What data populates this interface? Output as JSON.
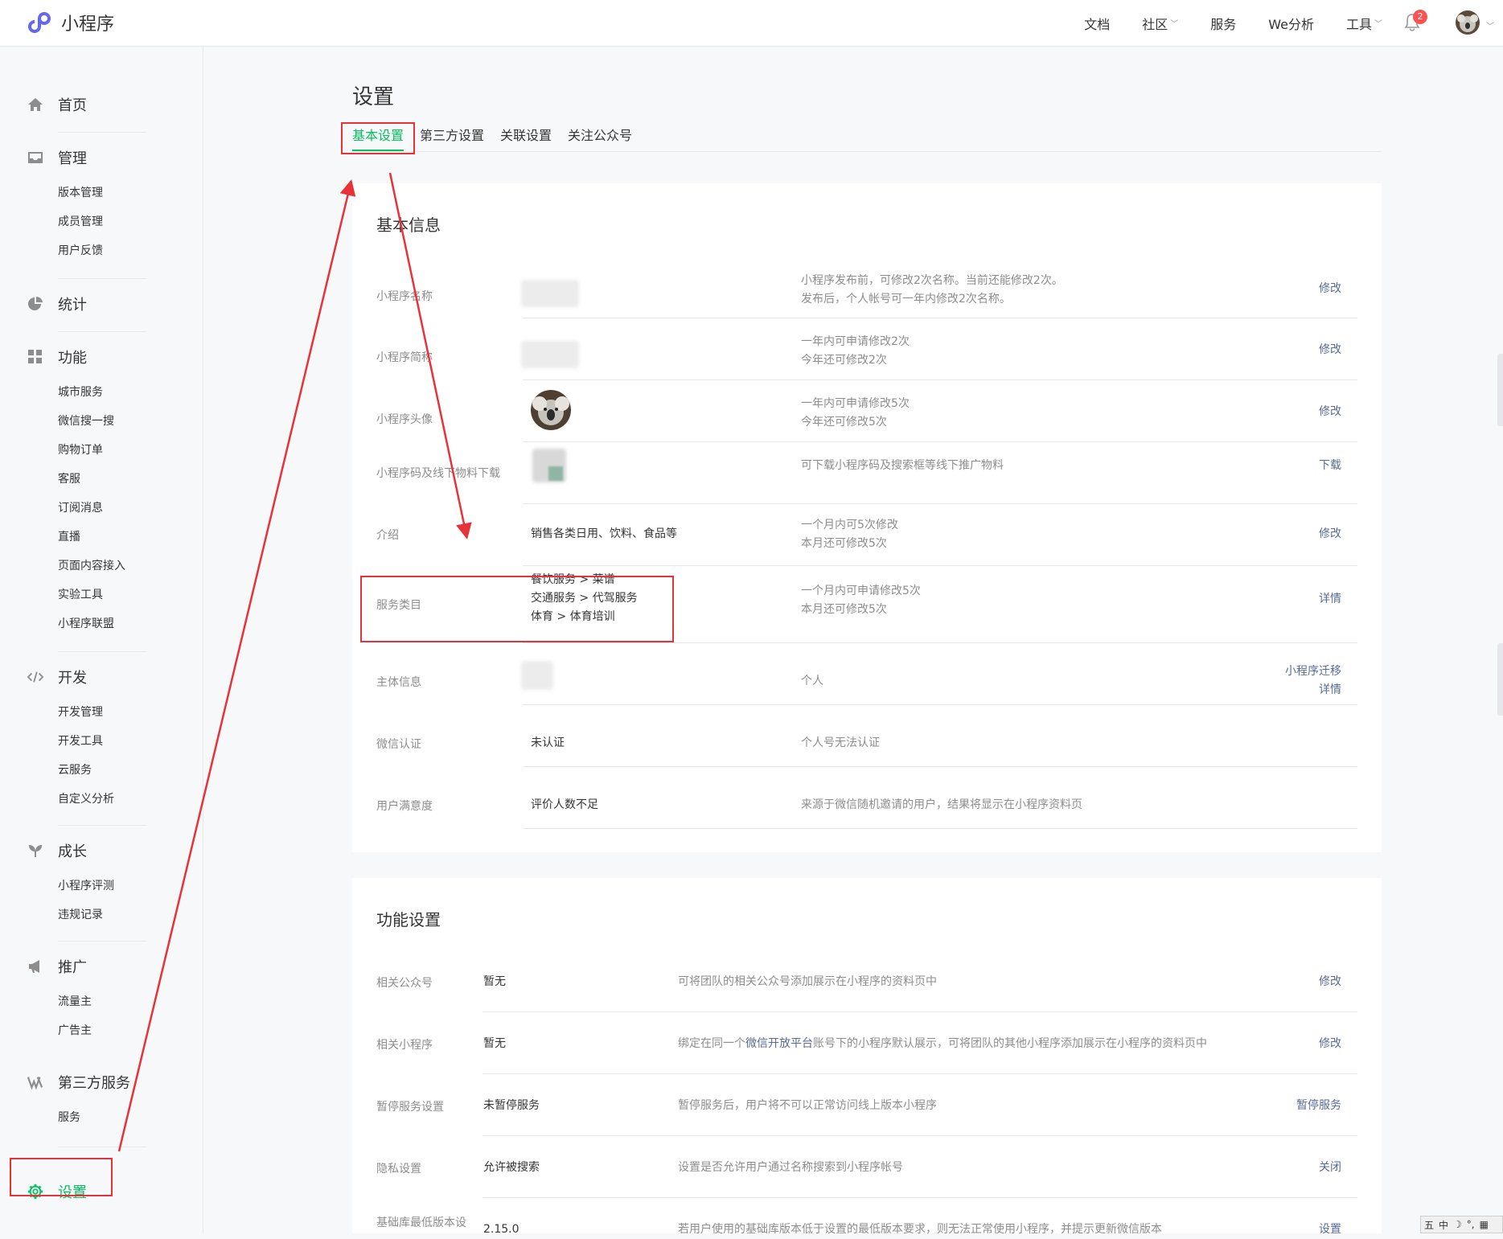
{
  "brand": {
    "name": "小程序"
  },
  "topnav": [
    {
      "label": "文档",
      "caret": false
    },
    {
      "label": "社区",
      "caret": true
    },
    {
      "label": "服务",
      "caret": false
    },
    {
      "label": "We分析",
      "caret": false
    },
    {
      "label": "工具",
      "caret": true
    }
  ],
  "notifications": {
    "count": "2"
  },
  "colors": {
    "accent": "#07c160",
    "link": "#576b95",
    "annotation": "#e8323a",
    "badge": "#fa5151"
  },
  "sidebar": {
    "home": "首页",
    "manage": {
      "title": "管理",
      "items": [
        "版本管理",
        "成员管理",
        "用户反馈"
      ]
    },
    "stats": "统计",
    "features": {
      "title": "功能",
      "items": [
        "城市服务",
        "微信搜一搜",
        "购物订单",
        "客服",
        "订阅消息",
        "直播",
        "页面内容接入",
        "实验工具",
        "小程序联盟"
      ]
    },
    "dev": {
      "title": "开发",
      "items": [
        "开发管理",
        "开发工具",
        "云服务",
        "自定义分析"
      ]
    },
    "growth": {
      "title": "成长",
      "items": [
        "小程序评测",
        "违规记录"
      ]
    },
    "promo": {
      "title": "推广",
      "items": [
        "流量主",
        "广告主"
      ]
    },
    "thirdparty": {
      "title": "第三方服务",
      "items": [
        "服务"
      ]
    },
    "settings": "设置"
  },
  "page": {
    "title": "设置",
    "tabs": [
      "基本设置",
      "第三方设置",
      "关联设置",
      "关注公众号"
    ]
  },
  "basic": {
    "title": "基本信息",
    "rows": [
      {
        "label": "小程序名称",
        "value": "",
        "desc1": "小程序发布前，可修改2次名称。当前还能修改2次。",
        "desc2": "发布后，个人帐号可一年内修改2次名称。",
        "action": "修改"
      },
      {
        "label": "小程序简称",
        "value": "",
        "desc1": "一年内可申请修改2次",
        "desc2": "今年还可修改2次",
        "action": "修改"
      },
      {
        "label": "小程序头像",
        "value": "",
        "desc1": "一年内可申请修改5次",
        "desc2": "今年还可修改5次",
        "action": "修改"
      },
      {
        "label": "小程序码及线下物料下载",
        "value": "",
        "desc1": "可下载小程序码及搜索框等线下推广物料",
        "desc2": "",
        "action": "下载"
      },
      {
        "label": "介绍",
        "value": "销售各类日用、饮料、食品等",
        "desc1": "一个月内可5次修改",
        "desc2": "本月还可修改5次",
        "action": "修改"
      },
      {
        "label": "服务类目",
        "value1": "餐饮服务 > 菜谱",
        "value2": "交通服务 > 代驾服务",
        "value3": "体育 > 体育培训",
        "desc1": "一个月内可申请修改5次",
        "desc2": "本月还可修改5次",
        "action": "详情"
      },
      {
        "label": "主体信息",
        "value": "",
        "desc1": "个人",
        "desc2": "",
        "action": "小程序迁移",
        "action2": "详情"
      },
      {
        "label": "微信认证",
        "value": "未认证",
        "desc1": "个人号无法认证",
        "desc2": "",
        "action": ""
      },
      {
        "label": "用户满意度",
        "value": "评价人数不足",
        "desc1": "来源于微信随机邀请的用户，结果将显示在小程序资料页",
        "desc2": "",
        "action": ""
      }
    ]
  },
  "features": {
    "title": "功能设置",
    "rows": [
      {
        "label": "相关公众号",
        "value": "暂无",
        "desc": "可将团队的相关公众号添加展示在小程序的资料页中",
        "action": "修改"
      },
      {
        "label": "相关小程序",
        "value": "暂无",
        "desc_pre": "绑定在同一个",
        "desc_link": "微信开放平台",
        "desc_post": "账号下的小程序默认展示，可将团队的其他小程序添加展示在小程序的资料页中",
        "action": "修改"
      },
      {
        "label": "暂停服务设置",
        "value": "未暂停服务",
        "desc": "暂停服务后，用户将不可以正常访问线上版本小程序",
        "action": "暂停服务"
      },
      {
        "label": "隐私设置",
        "value": "允许被搜索",
        "desc": "设置是否允许用户通过名称搜索到小程序帐号",
        "action": "关闭"
      },
      {
        "label": "基础库最低版本设",
        "value": "2.15.0",
        "desc": "若用户使用的基础库版本低于设置的最低版本要求，则无法正常使用小程序，并提示更新微信版本",
        "action": "设置"
      }
    ]
  },
  "ime": {
    "label1": "五",
    "label2": "中"
  }
}
